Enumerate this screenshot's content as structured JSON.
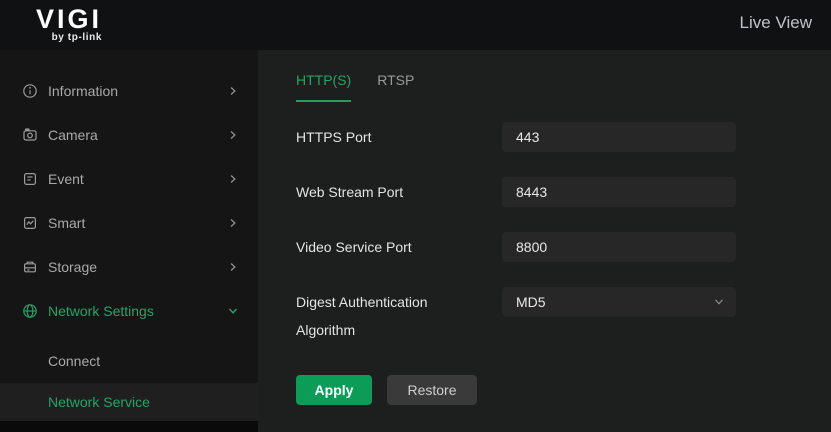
{
  "brand": {
    "logo": "VIGI",
    "tagline": "by tp-link"
  },
  "topbar": {
    "live_view": "Live View"
  },
  "sidebar": {
    "items": [
      {
        "label": "Information",
        "icon": "info-icon",
        "active": false
      },
      {
        "label": "Camera",
        "icon": "camera-icon",
        "active": false
      },
      {
        "label": "Event",
        "icon": "event-icon",
        "active": false
      },
      {
        "label": "Smart",
        "icon": "smart-icon",
        "active": false
      },
      {
        "label": "Storage",
        "icon": "storage-icon",
        "active": false
      },
      {
        "label": "Network Settings",
        "icon": "globe-icon",
        "active": true,
        "expanded": true
      }
    ],
    "subitems": [
      {
        "label": "Connect",
        "active": false
      },
      {
        "label": "Network Service",
        "active": true
      }
    ]
  },
  "main": {
    "tabs": [
      {
        "label": "HTTP(S)",
        "active": true
      },
      {
        "label": "RTSP",
        "active": false
      }
    ],
    "fields": [
      {
        "label": "HTTPS Port",
        "value": "443",
        "control": "input"
      },
      {
        "label": "Web Stream Port",
        "value": "8443",
        "control": "input"
      },
      {
        "label": "Video Service Port",
        "value": "8800",
        "control": "input"
      },
      {
        "label": "Digest Authentication Algorithm",
        "value": "MD5",
        "control": "select"
      }
    ],
    "actions": {
      "apply": "Apply",
      "restore": "Restore"
    }
  },
  "colors": {
    "accent_text": "#23a566",
    "accent_button": "#0b9d57",
    "topbar_bg": "#101112",
    "sidebar_bg": "#151515",
    "main_bg": "#1d1e1e",
    "input_bg": "#272727",
    "highlight_row": "#1f1f1f"
  }
}
